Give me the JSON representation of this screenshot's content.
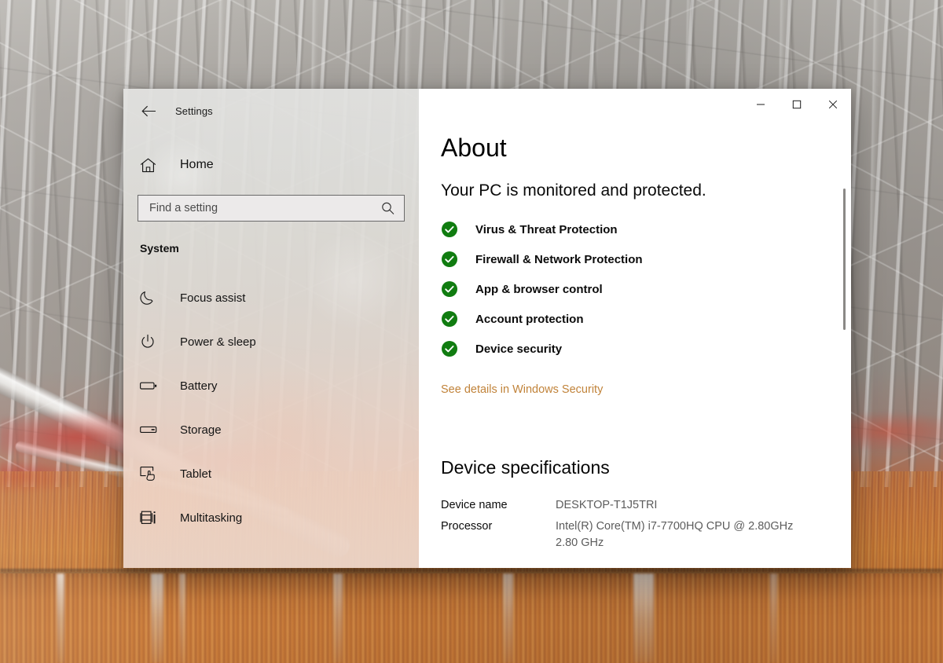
{
  "window": {
    "app_title": "Settings",
    "back_icon": "back-arrow-icon",
    "controls": {
      "minimize_label": "Minimize",
      "maximize_label": "Maximize",
      "close_label": "Close"
    }
  },
  "sidebar": {
    "home": {
      "label": "Home",
      "icon": "home-icon"
    },
    "search": {
      "placeholder": "Find a setting",
      "value": "",
      "icon": "search-icon"
    },
    "group_title": "System",
    "items": [
      {
        "label": "Focus assist",
        "icon": "moon-icon"
      },
      {
        "label": "Power & sleep",
        "icon": "power-icon"
      },
      {
        "label": "Battery",
        "icon": "battery-icon"
      },
      {
        "label": "Storage",
        "icon": "storage-icon"
      },
      {
        "label": "Tablet",
        "icon": "tablet-touch-icon"
      },
      {
        "label": "Multitasking",
        "icon": "multitasking-icon"
      }
    ]
  },
  "main": {
    "heading": "About",
    "protection_status": "Your PC is monitored and protected.",
    "status_items": [
      {
        "label": "Virus & Threat Protection",
        "state": "ok"
      },
      {
        "label": "Firewall & Network Protection",
        "state": "ok"
      },
      {
        "label": "App & browser control",
        "state": "ok"
      },
      {
        "label": "Account protection",
        "state": "ok"
      },
      {
        "label": "Device security",
        "state": "ok"
      }
    ],
    "security_link": "See details in Windows Security",
    "specs_heading": "Device specifications",
    "specs": [
      {
        "key": "Device name",
        "value": "DESKTOP-T1J5TRI"
      },
      {
        "key": "Processor",
        "value": "Intel(R) Core(TM) i7-7700HQ CPU @ 2.80GHz\n2.80 GHz"
      }
    ]
  },
  "colors": {
    "status_ok_green": "#107C10",
    "link_amber": "#C1833A",
    "content_background": "#FFFFFF",
    "sidebar_tint_top": "#E2E2E0",
    "sidebar_tint_bottom": "#ECD5C7",
    "scrollbar_thumb": "#8A8886"
  }
}
